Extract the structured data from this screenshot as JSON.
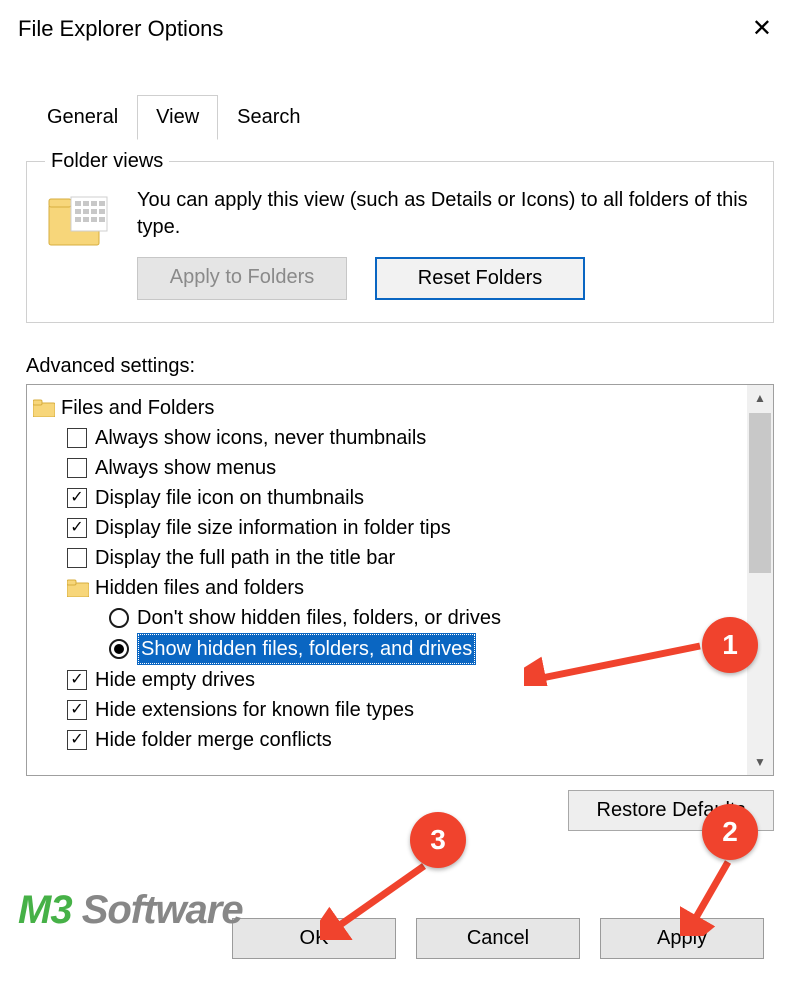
{
  "window": {
    "title": "File Explorer Options"
  },
  "tabs": {
    "general": "General",
    "view": "View",
    "search": "Search",
    "active": "view"
  },
  "folderViews": {
    "legend": "Folder views",
    "text": "You can apply this view (such as Details or Icons) to all folders of this type.",
    "applyBtn": "Apply to Folders",
    "resetBtn": "Reset Folders"
  },
  "advanced": {
    "label": "Advanced settings:",
    "root": "Files and Folders",
    "items": [
      {
        "label": "Always show icons, never thumbnails",
        "checked": false
      },
      {
        "label": "Always show menus",
        "checked": false
      },
      {
        "label": "Display file icon on thumbnails",
        "checked": true
      },
      {
        "label": "Display file size information in folder tips",
        "checked": true
      },
      {
        "label": "Display the full path in the title bar",
        "checked": false
      }
    ],
    "hiddenGroup": "Hidden files and folders",
    "radios": [
      {
        "label": "Don't show hidden files, folders, or drives",
        "selected": false
      },
      {
        "label": "Show hidden files, folders, and drives",
        "selected": true
      }
    ],
    "items2": [
      {
        "label": "Hide empty drives",
        "checked": true
      },
      {
        "label": "Hide extensions for known file types",
        "checked": true
      },
      {
        "label": "Hide folder merge conflicts",
        "checked": true
      }
    ],
    "restore": "Restore Defaults"
  },
  "buttons": {
    "ok": "OK",
    "cancel": "Cancel",
    "apply": "Apply"
  },
  "annotations": {
    "b1": "1",
    "b2": "2",
    "b3": "3"
  },
  "watermark": {
    "m3": "M3",
    "rest": " Software"
  }
}
